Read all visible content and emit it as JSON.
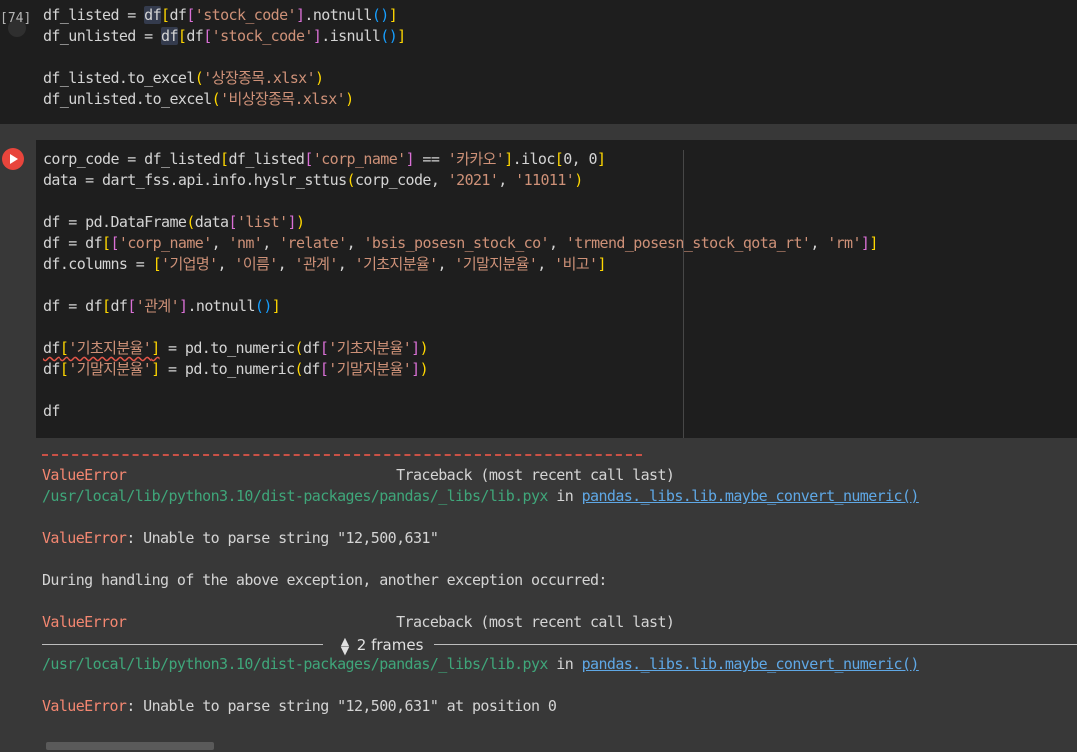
{
  "cell1": {
    "exec_count": "[74]",
    "lines": [
      [
        {
          "t": "df_listed = ",
          "c": "t"
        },
        {
          "t": "df",
          "c": "t hl"
        },
        {
          "t": "[",
          "c": "y"
        },
        {
          "t": "df",
          "c": "t"
        },
        {
          "t": "[",
          "c": "p"
        },
        {
          "t": "'stock_code'",
          "c": "s"
        },
        {
          "t": "]",
          "c": "p"
        },
        {
          "t": ".notnull",
          "c": "t"
        },
        {
          "t": "()",
          "c": "b"
        },
        {
          "t": "]",
          "c": "y"
        }
      ],
      [
        {
          "t": "df_unlisted = ",
          "c": "t"
        },
        {
          "t": "df",
          "c": "t hl"
        },
        {
          "t": "[",
          "c": "y"
        },
        {
          "t": "df",
          "c": "t"
        },
        {
          "t": "[",
          "c": "p"
        },
        {
          "t": "'stock_code'",
          "c": "s"
        },
        {
          "t": "]",
          "c": "p"
        },
        {
          "t": ".isnull",
          "c": "t"
        },
        {
          "t": "()",
          "c": "b"
        },
        {
          "t": "]",
          "c": "y"
        }
      ],
      [],
      [
        {
          "t": "df_listed.to_excel",
          "c": "t"
        },
        {
          "t": "(",
          "c": "y"
        },
        {
          "t": "'상장종목.xlsx'",
          "c": "s"
        },
        {
          "t": ")",
          "c": "y"
        }
      ],
      [
        {
          "t": "df_unlisted.to_excel",
          "c": "t"
        },
        {
          "t": "(",
          "c": "y"
        },
        {
          "t": "'비상장종목.xlsx'",
          "c": "s"
        },
        {
          "t": ")",
          "c": "y"
        }
      ]
    ]
  },
  "cell2": {
    "lines": [
      [
        {
          "t": "corp_code = df_listed",
          "c": "t"
        },
        {
          "t": "[",
          "c": "y"
        },
        {
          "t": "df_listed",
          "c": "t"
        },
        {
          "t": "[",
          "c": "p"
        },
        {
          "t": "'corp_name'",
          "c": "s"
        },
        {
          "t": "]",
          "c": "p"
        },
        {
          "t": " == ",
          "c": "t"
        },
        {
          "t": "'카카오'",
          "c": "s"
        },
        {
          "t": "]",
          "c": "y"
        },
        {
          "t": ".iloc",
          "c": "t"
        },
        {
          "t": "[",
          "c": "y"
        },
        {
          "t": "0, 0",
          "c": "t"
        },
        {
          "t": "]",
          "c": "y"
        }
      ],
      [
        {
          "t": "data = dart_fss.api.info.hyslr_sttus",
          "c": "t"
        },
        {
          "t": "(",
          "c": "y"
        },
        {
          "t": "corp_code, ",
          "c": "t"
        },
        {
          "t": "'2021'",
          "c": "s"
        },
        {
          "t": ", ",
          "c": "t"
        },
        {
          "t": "'11011'",
          "c": "s"
        },
        {
          "t": ")",
          "c": "y"
        }
      ],
      [],
      [
        {
          "t": "df = pd.DataFrame",
          "c": "t"
        },
        {
          "t": "(",
          "c": "y"
        },
        {
          "t": "data",
          "c": "t"
        },
        {
          "t": "[",
          "c": "p"
        },
        {
          "t": "'list'",
          "c": "s"
        },
        {
          "t": "]",
          "c": "p"
        },
        {
          "t": ")",
          "c": "y"
        }
      ],
      [
        {
          "t": "df = df",
          "c": "t"
        },
        {
          "t": "[",
          "c": "y"
        },
        {
          "t": "[",
          "c": "p"
        },
        {
          "t": "'corp_name'",
          "c": "s"
        },
        {
          "t": ", ",
          "c": "t"
        },
        {
          "t": "'nm'",
          "c": "s"
        },
        {
          "t": ", ",
          "c": "t"
        },
        {
          "t": "'relate'",
          "c": "s"
        },
        {
          "t": ", ",
          "c": "t"
        },
        {
          "t": "'bsis_posesn_stock_co'",
          "c": "s"
        },
        {
          "t": ", ",
          "c": "t"
        },
        {
          "t": "'trmend_posesn_stock_qota_rt'",
          "c": "s"
        },
        {
          "t": ", ",
          "c": "t"
        },
        {
          "t": "'rm'",
          "c": "s"
        },
        {
          "t": "]",
          "c": "p"
        },
        {
          "t": "]",
          "c": "y"
        }
      ],
      [
        {
          "t": "df.columns = ",
          "c": "t"
        },
        {
          "t": "[",
          "c": "y"
        },
        {
          "t": "'기업명'",
          "c": "s"
        },
        {
          "t": ", ",
          "c": "t"
        },
        {
          "t": "'이름'",
          "c": "s"
        },
        {
          "t": ", ",
          "c": "t"
        },
        {
          "t": "'관계'",
          "c": "s"
        },
        {
          "t": ", ",
          "c": "t"
        },
        {
          "t": "'기초지분율'",
          "c": "s"
        },
        {
          "t": ", ",
          "c": "t"
        },
        {
          "t": "'기말지분율'",
          "c": "s"
        },
        {
          "t": ", ",
          "c": "t"
        },
        {
          "t": "'비고'",
          "c": "s"
        },
        {
          "t": "]",
          "c": "y"
        }
      ],
      [],
      [
        {
          "t": "df = df",
          "c": "t"
        },
        {
          "t": "[",
          "c": "y"
        },
        {
          "t": "df",
          "c": "t"
        },
        {
          "t": "[",
          "c": "p"
        },
        {
          "t": "'관계'",
          "c": "s"
        },
        {
          "t": "]",
          "c": "p"
        },
        {
          "t": ".notnull",
          "c": "t"
        },
        {
          "t": "()",
          "c": "b"
        },
        {
          "t": "]",
          "c": "y"
        }
      ],
      [],
      [
        {
          "t": "df",
          "c": "t squig"
        },
        {
          "t": "[",
          "c": "y squig"
        },
        {
          "t": "'기초지분율'",
          "c": "s squig"
        },
        {
          "t": "]",
          "c": "y squig"
        },
        {
          "t": " = pd.to_numeric",
          "c": "t"
        },
        {
          "t": "(",
          "c": "y"
        },
        {
          "t": "df",
          "c": "t"
        },
        {
          "t": "[",
          "c": "p"
        },
        {
          "t": "'기초지분율'",
          "c": "s"
        },
        {
          "t": "]",
          "c": "p"
        },
        {
          "t": ")",
          "c": "y"
        }
      ],
      [
        {
          "t": "df",
          "c": "t"
        },
        {
          "t": "[",
          "c": "y"
        },
        {
          "t": "'기말지분율'",
          "c": "s"
        },
        {
          "t": "]",
          "c": "y"
        },
        {
          "t": " = pd.to_numeric",
          "c": "t"
        },
        {
          "t": "(",
          "c": "y"
        },
        {
          "t": "df",
          "c": "t"
        },
        {
          "t": "[",
          "c": "p"
        },
        {
          "t": "'기말지분율'",
          "c": "s"
        },
        {
          "t": "]",
          "c": "p"
        },
        {
          "t": ")",
          "c": "y"
        }
      ],
      [],
      [
        {
          "t": "df",
          "c": "t"
        }
      ]
    ]
  },
  "output": {
    "lines": [
      [],
      [
        {
          "t": "ValueError",
          "c": "err"
        },
        {
          "t": "                                Traceback (most recent call last)",
          "c": "t"
        }
      ],
      [
        {
          "t": "/usr/local/lib/python3.10/dist-packages/pandas/_libs/lib.pyx",
          "c": "g"
        },
        {
          "t": " in ",
          "c": "t"
        },
        {
          "t": "pandas._libs.lib.maybe_convert_numeric()",
          "c": "lk"
        }
      ],
      [],
      [
        {
          "t": "ValueError",
          "c": "err"
        },
        {
          "t": ": Unable to parse string \"12,500,631\"",
          "c": "t"
        }
      ],
      [],
      [
        {
          "t": "During handling of the above exception, another exception occurred:",
          "c": "t"
        }
      ],
      [],
      [
        {
          "t": "ValueError",
          "c": "err"
        },
        {
          "t": "                                Traceback (most recent call last)",
          "c": "t"
        }
      ],
      [],
      [
        {
          "t": "/usr/local/lib/python3.10/dist-packages/pandas/_libs/lib.pyx",
          "c": "g"
        },
        {
          "t": " in ",
          "c": "t"
        },
        {
          "t": "pandas._libs.lib.maybe_convert_numeric()",
          "c": "lk"
        }
      ],
      [],
      [
        {
          "t": "ValueError",
          "c": "err"
        },
        {
          "t": ": Unable to parse string \"12,500,631\" at position 0",
          "c": "t"
        }
      ]
    ],
    "frames_label": "2 frames",
    "frames_icon": "unfold-icon"
  }
}
